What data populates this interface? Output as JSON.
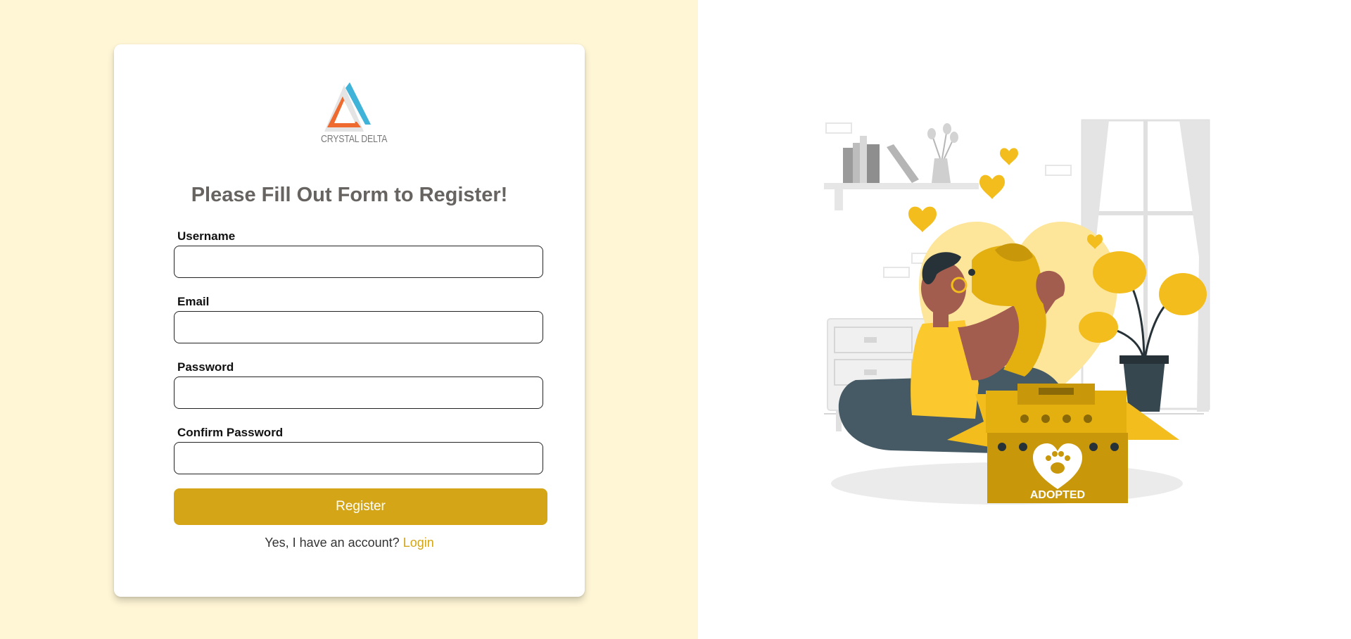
{
  "brand": {
    "name": "CRYSTAL DELTA"
  },
  "form": {
    "title": "Please Fill Out Form to Register!",
    "fields": [
      {
        "label": "Username",
        "value": "",
        "type": "text"
      },
      {
        "label": "Email",
        "value": "",
        "type": "email"
      },
      {
        "label": "Password",
        "value": "",
        "type": "password"
      },
      {
        "label": "Confirm Password",
        "value": "",
        "type": "password"
      }
    ],
    "submit_label": "Register",
    "login_prompt": "Yes, I have an account?",
    "login_link": "Login"
  },
  "illustration": {
    "badge_text": "ADOPTED",
    "icon": "adoption-illustration"
  },
  "colors": {
    "left_background": "#fff6d6",
    "accent": "#d4a517",
    "title": "#666360"
  }
}
